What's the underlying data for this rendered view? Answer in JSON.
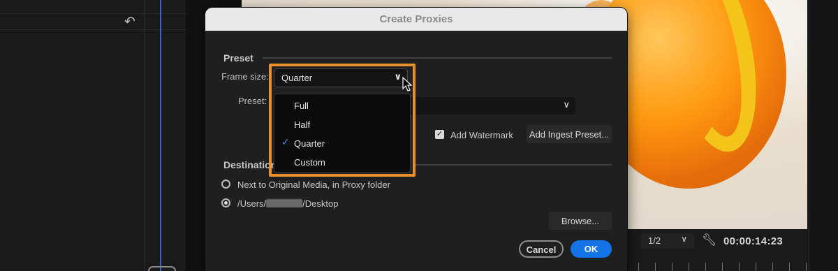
{
  "dialog": {
    "title": "Create Proxies",
    "preset_section": "Preset",
    "frame_size_label": "Frame size:",
    "frame_size_value": "Quarter",
    "preset_label": "Preset:",
    "preset_value": "",
    "add_watermark_label": "Add Watermark",
    "add_watermark_checked": true,
    "add_ingest_preset_button": "Add Ingest Preset...",
    "destination_section": "Destination",
    "destination_options": [
      {
        "label": "Next to Original Media, in Proxy folder",
        "selected": false
      },
      {
        "label_prefix": "/Users/",
        "label_suffix": "/Desktop",
        "selected": true
      }
    ],
    "browse_button": "Browse...",
    "cancel_button": "Cancel",
    "ok_button": "OK"
  },
  "frame_size_menu": {
    "items": [
      {
        "label": "Full",
        "checked": false
      },
      {
        "label": "Half",
        "checked": false
      },
      {
        "label": "Quarter",
        "checked": true
      },
      {
        "label": "Custom",
        "checked": false
      }
    ]
  },
  "viewer": {
    "zoom_value": "1/2",
    "timecode": "00:00:14:23"
  },
  "colors": {
    "accent_blue": "#1473e6",
    "highlight_orange": "#e8902e",
    "checkmark_blue": "#4a8cf0"
  },
  "icons": [
    "undo-icon",
    "chevron-down-icon",
    "checkmark-icon",
    "wrench-icon",
    "mouse-cursor-icon"
  ]
}
